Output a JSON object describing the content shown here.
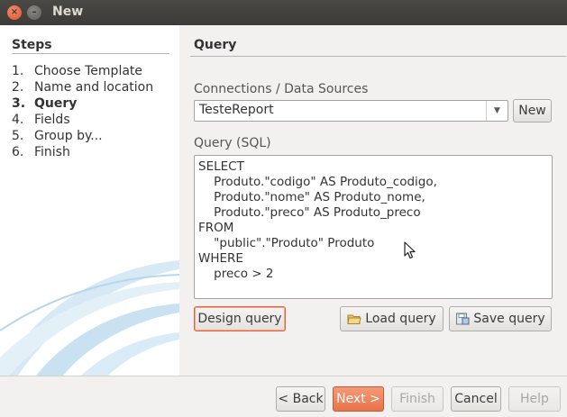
{
  "window": {
    "title": "New",
    "close_glyph": "×",
    "min_glyph": "–"
  },
  "steps": {
    "title": "Steps",
    "items": [
      {
        "num": "1.",
        "label": "Choose Template"
      },
      {
        "num": "2.",
        "label": "Name and location"
      },
      {
        "num": "3.",
        "label": "Query",
        "current": true
      },
      {
        "num": "4.",
        "label": "Fields"
      },
      {
        "num": "5.",
        "label": "Group by..."
      },
      {
        "num": "6.",
        "label": "Finish"
      }
    ]
  },
  "query": {
    "section_title": "Query",
    "connections_label": "Connections / Data Sources",
    "connection_value": "TesteReport",
    "new_button": "New",
    "sql_label": "Query (SQL)",
    "sql_lines": [
      "SELECT",
      "    Produto.\"codigo\" AS Produto_codigo,",
      "    Produto.\"nome\" AS Produto_nome,",
      "    Produto.\"preco\" AS Produto_preco",
      "FROM",
      "    \"public\".\"Produto\" Produto",
      "WHERE",
      "    preco > 2"
    ],
    "design_button": "Design query",
    "load_button": "Load query",
    "save_button": "Save query"
  },
  "footer": {
    "back_button": "< Back",
    "next_button": "Next >",
    "finish_button": "Finish",
    "cancel_button": "Cancel",
    "help_button": "Help"
  },
  "colors": {
    "accent": "#e8734a",
    "titlebar": "#3c3b37",
    "swoosh": "#cfe5f3"
  },
  "icons": {
    "combo_arrow": "dropdown-arrow-icon",
    "load": "folder-icon",
    "save": "save-icon",
    "cursor": "mouse-pointer-icon"
  }
}
